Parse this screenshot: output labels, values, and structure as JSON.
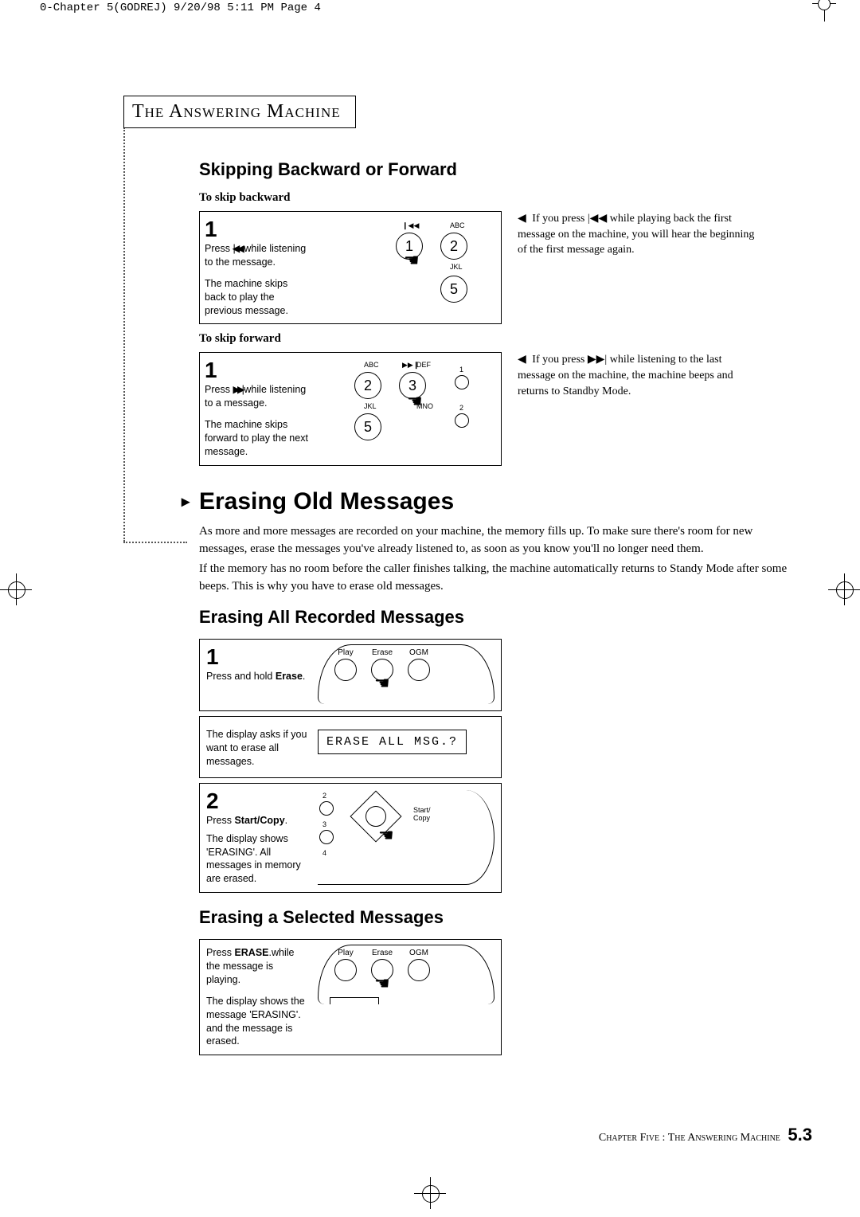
{
  "print_meta": {
    "header": "0-Chapter 5(GODREJ)  9/20/98 5:11 PM  Page 4"
  },
  "section_box_title": "The  Answering  Machine",
  "skip": {
    "heading": "Skipping Backward or Forward",
    "backward": {
      "label": "To skip backward",
      "step_num": "1",
      "line1": "Press ",
      "icon_name": "|◀◀",
      "line1b": " while listening to the message.",
      "line2": "The machine skips back to play the previous message.",
      "note": "If you press |◀◀ while playing back the first message on the machine, you will hear the beginning of the first message again.",
      "keypad": {
        "k1": "1",
        "k2": "2",
        "k5": "5",
        "abc": "ABC",
        "jkl": "JKL",
        "rew": "❙◀◀"
      }
    },
    "forward": {
      "label": "To skip forward",
      "step_num": "1",
      "line1": "Press ",
      "icon_name": "▶▶|",
      "line1b": " while listening to a message.",
      "line2": "The machine skips forward to play the next message.",
      "note": "If you press ▶▶| while listening to the last message on the machine, the machine beeps and returns to Standby Mode.",
      "keypad": {
        "k2": "2",
        "k3": "3",
        "k5": "5",
        "abc": "ABC",
        "def": "DEF",
        "jkl": "JKL",
        "mno": "MNO",
        "fwd": "▶▶❙",
        "d1": "1",
        "d2": "2"
      }
    }
  },
  "erase": {
    "heading": "Erasing Old Messages",
    "para1": "As more and more messages are recorded on your machine, the memory fills up. To make sure there's room for new messages, erase the messages you've already listened to, as soon as you know you'll no longer need them.",
    "para2": "If the memory has no room before the caller finishes talking, the machine automatically returns to Standy Mode after some beeps. This is why you have to erase old messages.",
    "all": {
      "heading": "Erasing All Recorded Messages",
      "step1_num": "1",
      "step1_text_a": "Press and hold ",
      "step1_text_b": "Erase",
      "step1_text_c": ".",
      "btn_play": "Play",
      "btn_erase": "Erase",
      "btn_ogm": "OGM",
      "ask_text": "The display asks if you want to erase all messages.",
      "lcd": "ERASE ALL MSG.?",
      "step2_num": "2",
      "step2_text_a": "Press ",
      "step2_text_b": "Start/Copy",
      "step2_text_c": ".",
      "step2_text2": "The display shows 'ERASING'. All messages in memory are erased.",
      "start_copy": "Start/\nCopy",
      "d2": "2",
      "d3": "3",
      "d4": "4"
    },
    "selected": {
      "heading": "Erasing a Selected Messages",
      "text_a": "Press ",
      "text_b": "ERASE",
      "text_c": ".while the message is playing.",
      "text2": "The display shows the message 'ERASING'. and the message is erased.",
      "btn_play": "Play",
      "btn_erase": "Erase",
      "btn_ogm": "OGM"
    }
  },
  "footer": {
    "text": "Chapter Five : The Answering Machine",
    "page": "5.3"
  }
}
